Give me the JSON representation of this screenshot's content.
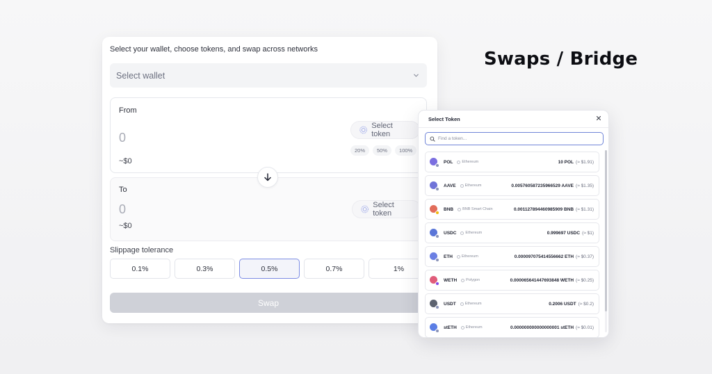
{
  "headline": "Swaps / Bridge",
  "swap": {
    "caption": "Select your wallet, choose tokens, and swap across networks",
    "wallet_placeholder": "Select wallet",
    "from": {
      "label": "From",
      "amount": "0",
      "usd": "~$0",
      "select_token": "Select token",
      "percents": [
        "20%",
        "50%",
        "100%"
      ]
    },
    "to": {
      "label": "To",
      "amount": "0",
      "usd": "~$0",
      "select_token": "Select token"
    },
    "slippage_title": "Slippage tolerance",
    "slippage_options": [
      "0.1%",
      "0.3%",
      "0.5%",
      "0.7%",
      "1%"
    ],
    "slippage_selected": "0.5%",
    "swap_label": "Swap"
  },
  "modal": {
    "title": "Select Token",
    "search_placeholder": "Find a token...",
    "tokens": [
      {
        "symbol": "POL",
        "network": "Ethereum",
        "balance": "10 POL",
        "usd": "(≈ $1.91)",
        "color": "#7b6fe0",
        "sub": "#8a93b8"
      },
      {
        "symbol": "AAVE",
        "network": "Ethereum",
        "balance": "0.005760587235966529 AAVE",
        "usd": "(≈ $1.35)",
        "color": "#6f73d8",
        "sub": "#8a93b8"
      },
      {
        "symbol": "BNB",
        "network": "BNB Smart Chain",
        "balance": "0.001127894460985909 BNB",
        "usd": "(≈ $1.31)",
        "color": "#e26d5a",
        "sub": "#f0b90b"
      },
      {
        "symbol": "USDC",
        "network": "Ethereum",
        "balance": "0.999697 USDC",
        "usd": "(≈ $1)",
        "color": "#5a76d8",
        "sub": "#8a93b8"
      },
      {
        "symbol": "ETH",
        "network": "Ethereum",
        "balance": "0.000097075414556662 ETH",
        "usd": "(≈ $0.37)",
        "color": "#6b7fe3",
        "sub": "#8a93b8"
      },
      {
        "symbol": "WETH",
        "network": "Polygon",
        "balance": "0.000065641447693848 WETH",
        "usd": "(≈ $0.25)",
        "color": "#e05c7a",
        "sub": "#8247e5"
      },
      {
        "symbol": "USDT",
        "network": "Ethereum",
        "balance": "0.2006 USDT",
        "usd": "(≈ $0.2)",
        "color": "#5d6370",
        "sub": "#8a93b8"
      },
      {
        "symbol": "stETH",
        "network": "Ethereum",
        "balance": "0.000000000000000001 stETH",
        "usd": "(≈ $0.01)",
        "color": "#5b7ee5",
        "sub": "#8a93b8"
      }
    ]
  },
  "colors": {
    "accent": "#7c8ce4",
    "swap_button": "#cfd1d8"
  }
}
